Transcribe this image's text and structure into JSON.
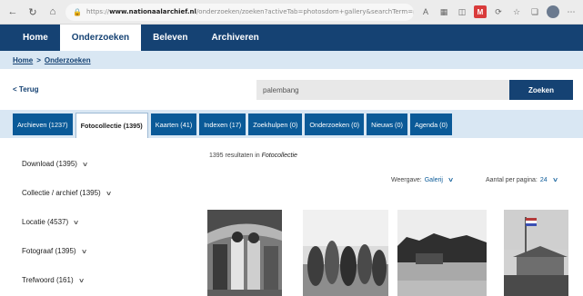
{
  "browser": {
    "url_prefix": "https://",
    "url_domain": "www.nationaalarchief.nl",
    "url_path": "/onderzoeken/zoeken?activeTab=photosdom+gallery&searchTerm=palembang",
    "ext_label": "M"
  },
  "main_nav": {
    "items": [
      {
        "label": "Home"
      },
      {
        "label": "Onderzoeken"
      },
      {
        "label": "Beleven"
      },
      {
        "label": "Archiveren"
      }
    ]
  },
  "breadcrumb": {
    "home": "Home",
    "separator": ">",
    "current": "Onderzoeken"
  },
  "search": {
    "back_label": "< Terug",
    "query": "palembang",
    "button_label": "Zoeken"
  },
  "tabs": [
    {
      "label": "Archieven (1237)"
    },
    {
      "label": "Fotocollectie (1395)",
      "active": true
    },
    {
      "label": "Kaarten (41)"
    },
    {
      "label": "Indexen (17)"
    },
    {
      "label": "Zoekhulpen (0)"
    },
    {
      "label": "Onderzoeken (0)"
    },
    {
      "label": "Nieuws (0)"
    },
    {
      "label": "Agenda (0)"
    }
  ],
  "facets": [
    {
      "label": "Download (1395)"
    },
    {
      "label": "Collectie / archief (1395)"
    },
    {
      "label": "Locatie (4537)"
    },
    {
      "label": "Fotograaf (1395)"
    },
    {
      "label": "Trefwoord (161)"
    }
  ],
  "results": {
    "count_text": "1395 resultaten in",
    "collection": "Fotocollectie",
    "view_label": "Weergave:",
    "view_value": "Galerij",
    "per_page_label": "Aantal per pagina:",
    "per_page_value": "24"
  },
  "colors": {
    "brand_navy": "#154273",
    "tab_blue": "#0a5a98",
    "light_band": "#d9e7f3"
  }
}
